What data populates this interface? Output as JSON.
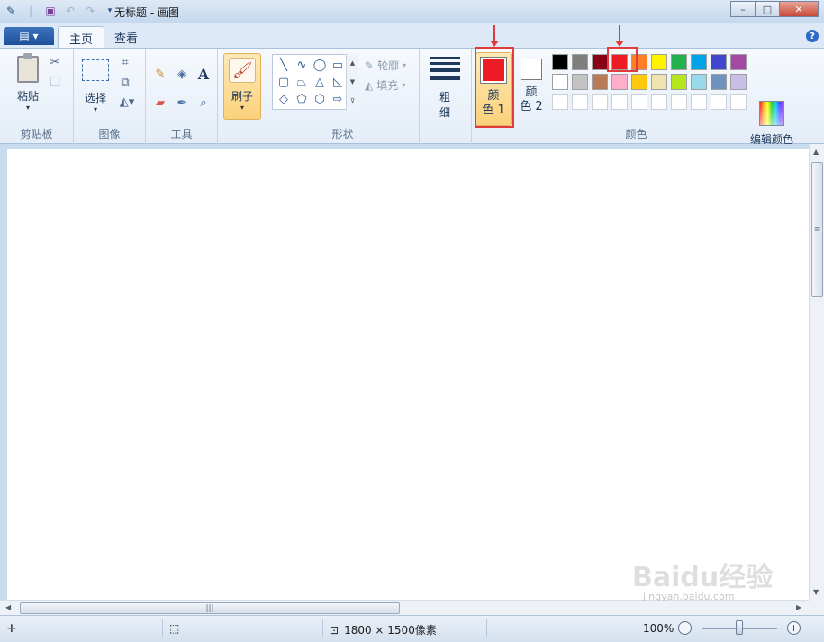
{
  "title_bar": {
    "title": "无标题 - 画图",
    "buttons": {
      "minimize": "–",
      "maximize": "□",
      "close": "✕"
    }
  },
  "tabs": {
    "app_menu": "▤ ▾",
    "items": [
      "主页",
      "查看"
    ],
    "help": "?"
  },
  "ribbon": {
    "clipboard": {
      "paste": "粘贴",
      "group": "剪贴板"
    },
    "image": {
      "select": "选择",
      "group": "图像"
    },
    "tools": {
      "group": "工具"
    },
    "brush": {
      "label": "刷子"
    },
    "shapes": {
      "outline": "轮廓",
      "fill": "填充",
      "group": "形状"
    },
    "size": {
      "line1": "粗",
      "line2": "细"
    },
    "colors": {
      "color1_line1": "颜",
      "color1_line2": "色 1",
      "color2_line1": "颜",
      "color2_line2": "色 2",
      "edit": "编辑颜色",
      "group": "颜色",
      "color1_value": "#ed1c24",
      "color2_value": "#ffffff",
      "palette": [
        "#000000",
        "#7f7f7f",
        "#880015",
        "#ed1c24",
        "#ff7f27",
        "#fff200",
        "#22b14c",
        "#00a2e8",
        "#3f48cc",
        "#a349a4",
        "#ffffff",
        "#c3c3c3",
        "#b97a57",
        "#ffaec9",
        "#ffc90e",
        "#efe4b0",
        "#b5e61d",
        "#99d9ea",
        "#7092be",
        "#c8bfe7",
        "",
        "",
        "",
        "",
        "",
        "",
        "",
        "",
        "",
        ""
      ]
    }
  },
  "annotation_color": "#e23b3b",
  "status_bar": {
    "canvas_size": "1800 × 1500像素",
    "zoom": "100%"
  },
  "watermark": {
    "main": "Baidu经验",
    "sub": "jingyan.baidu.com"
  }
}
